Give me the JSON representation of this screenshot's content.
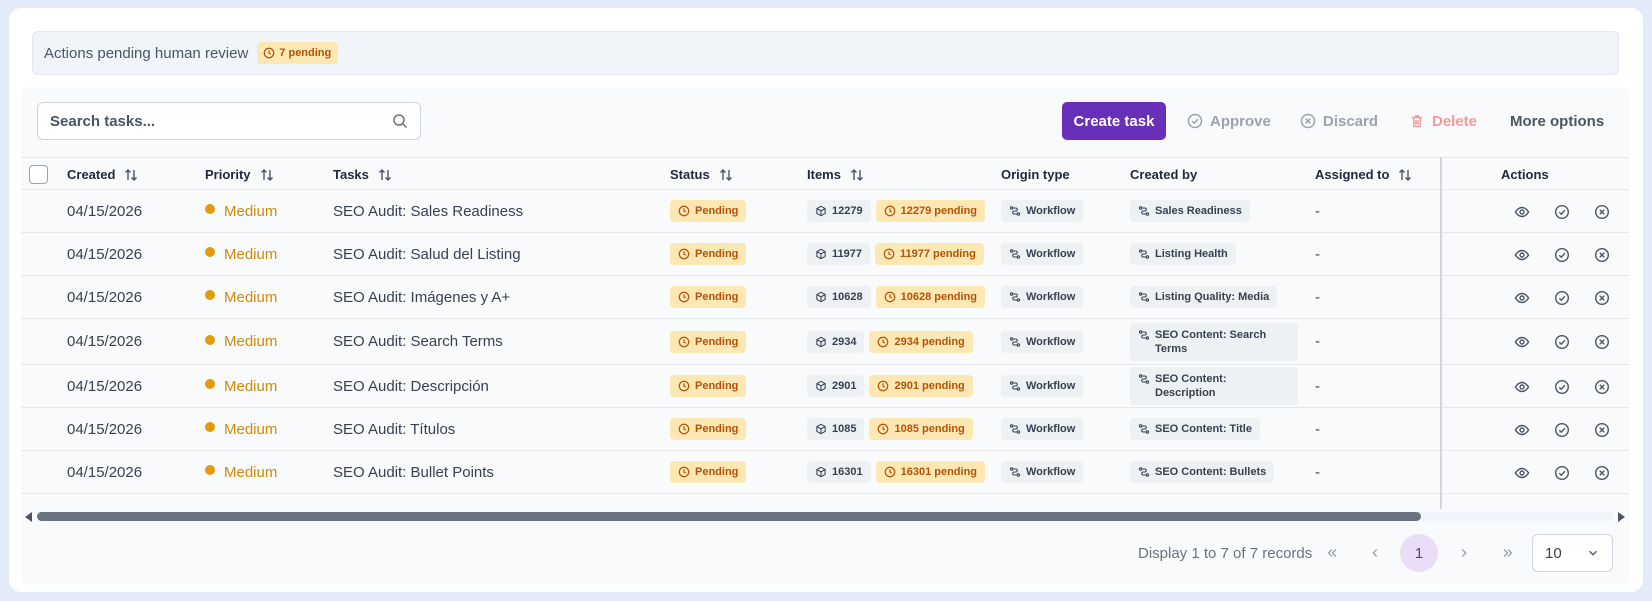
{
  "banner": {
    "text": "Actions pending human review",
    "pending_chip": "7 pending"
  },
  "search": {
    "placeholder": "Search tasks..."
  },
  "toolbar": {
    "create_label": "Create task",
    "approve_label": "Approve",
    "discard_label": "Discard",
    "delete_label": "Delete",
    "more_label": "More options"
  },
  "table": {
    "columns": {
      "created": "Created",
      "priority": "Priority",
      "tasks": "Tasks",
      "status": "Status",
      "items": "Items",
      "origin": "Origin type",
      "created_by": "Created by",
      "assigned_to": "Assigned to",
      "actions": "Actions"
    },
    "rows": [
      {
        "created": "04/15/2026",
        "priority": "Medium",
        "task": "SEO Audit: Sales Readiness",
        "status": "Pending",
        "items": "12279",
        "items_pending": "12279 pending",
        "origin": "Workflow",
        "created_by": "Sales Readiness",
        "assigned_to": "-"
      },
      {
        "created": "04/15/2026",
        "priority": "Medium",
        "task": "SEO Audit: Salud del Listing",
        "status": "Pending",
        "items": "11977",
        "items_pending": "11977 pending",
        "origin": "Workflow",
        "created_by": "Listing Health",
        "assigned_to": "-"
      },
      {
        "created": "04/15/2026",
        "priority": "Medium",
        "task": "SEO Audit: Imágenes y A+",
        "status": "Pending",
        "items": "10628",
        "items_pending": "10628 pending",
        "origin": "Workflow",
        "created_by": "Listing Quality: Media",
        "assigned_to": "-"
      },
      {
        "created": "04/15/2026",
        "priority": "Medium",
        "task": "SEO Audit: Search Terms",
        "status": "Pending",
        "items": "2934",
        "items_pending": "2934 pending",
        "origin": "Workflow",
        "created_by": "SEO Content: Search Terms",
        "assigned_to": "-"
      },
      {
        "created": "04/15/2026",
        "priority": "Medium",
        "task": "SEO Audit: Descripción",
        "status": "Pending",
        "items": "2901",
        "items_pending": "2901 pending",
        "origin": "Workflow",
        "created_by": "SEO Content: Description",
        "assigned_to": "-"
      },
      {
        "created": "04/15/2026",
        "priority": "Medium",
        "task": "SEO Audit: Títulos",
        "status": "Pending",
        "items": "1085",
        "items_pending": "1085 pending",
        "origin": "Workflow",
        "created_by": "SEO Content: Title",
        "assigned_to": "-"
      },
      {
        "created": "04/15/2026",
        "priority": "Medium",
        "task": "SEO Audit: Bullet Points",
        "status": "Pending",
        "items": "16301",
        "items_pending": "16301 pending",
        "origin": "Workflow",
        "created_by": "SEO Content: Bullets",
        "assigned_to": "-"
      }
    ]
  },
  "pagination": {
    "info": "Display 1 to 7 of 7 records",
    "current_page": "1",
    "page_size": "10"
  },
  "colors": {
    "primary": "#6a2fb8",
    "pending_bg": "#fde7b3",
    "pending_text": "#b45309",
    "priority_medium": "#e59a0c"
  }
}
